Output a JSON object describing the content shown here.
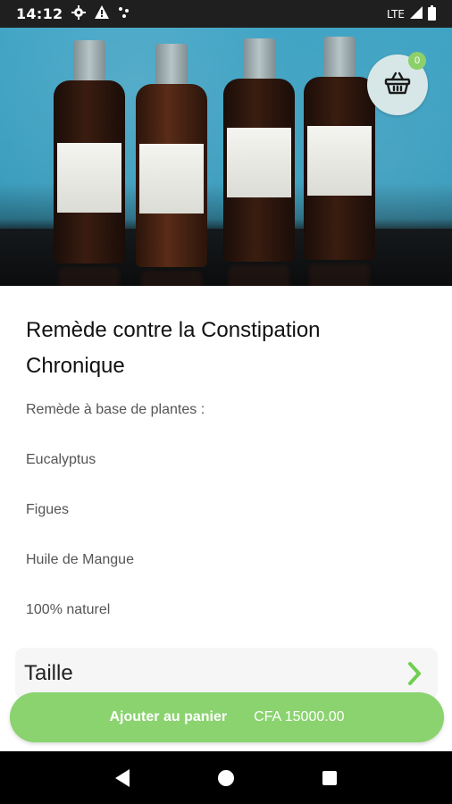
{
  "status_bar": {
    "time": "14:12",
    "network": "LTE",
    "icons": [
      "gear-icon",
      "warning-icon",
      "network-dots-icon",
      "signal-icon",
      "battery-icon"
    ]
  },
  "cart": {
    "count": "0",
    "icon": "basket-icon"
  },
  "product": {
    "title": "Remède contre la Constipation Chronique",
    "description_lines": [
      "Remède à base de plantes :",
      "Eucalyptus",
      "Figues",
      "Huile de Mangue",
      "100% naturel"
    ]
  },
  "size_option": {
    "label": "Taille",
    "icon": "chevron-right-icon"
  },
  "add_to_cart": {
    "label": "Ajouter au panier",
    "price": "CFA 15000.00"
  },
  "colors": {
    "accent": "#8ad36f",
    "cart_button_bg": "#d7e7e7"
  }
}
